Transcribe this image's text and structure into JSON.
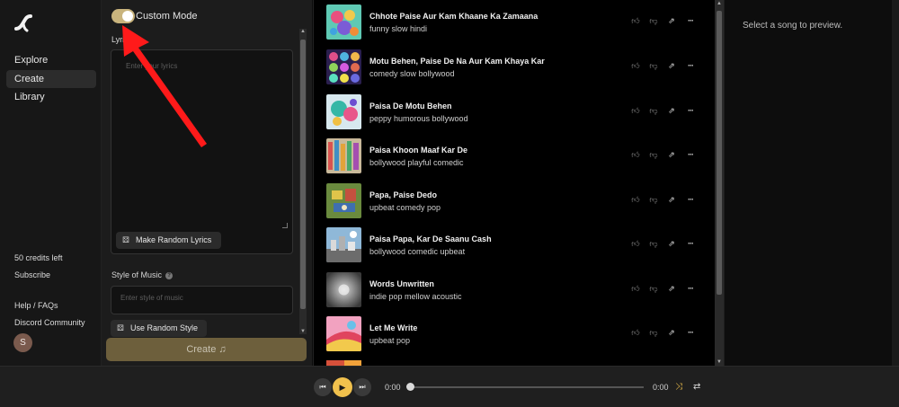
{
  "nav": {
    "items": [
      {
        "label": "Explore"
      },
      {
        "label": "Create",
        "active": true
      },
      {
        "label": "Library"
      }
    ],
    "credits": "50 credits left",
    "subscribe": "Subscribe",
    "help": "Help / FAQs",
    "discord": "Discord Community",
    "avatar_initial": "S"
  },
  "create": {
    "mode_label": "Custom Mode",
    "lyrics_label": "Lyrics",
    "lyrics_placeholder": "Enter your lyrics",
    "random_lyrics": "Make Random Lyrics",
    "style_label": "Style of Music",
    "style_placeholder": "Enter style of music",
    "random_style": "Use Random Style",
    "create_label": "Create ♫"
  },
  "songs": [
    {
      "title": "Chhote Paise Aur Kam Khaane Ka Zamaana",
      "tags": "funny slow hindi"
    },
    {
      "title": "Motu Behen, Paise De Na Aur Kam Khaya Kar",
      "tags": "comedy slow bollywood"
    },
    {
      "title": "Paisa De Motu Behen",
      "tags": "peppy humorous bollywood"
    },
    {
      "title": "Paisa Khoon Maaf Kar De",
      "tags": "bollywood playful comedic"
    },
    {
      "title": "Papa, Paise Dedo",
      "tags": "upbeat comedy pop"
    },
    {
      "title": "Paisa Papa, Kar De Saanu Cash",
      "tags": "bollywood comedic upbeat"
    },
    {
      "title": "Words Unwritten",
      "tags": "indie pop mellow acoustic"
    },
    {
      "title": "Let Me Write",
      "tags": "upbeat pop"
    }
  ],
  "preview": {
    "text": "Select a song to preview."
  },
  "player": {
    "current_time": "0:00",
    "duration": "0:00",
    "progress": 0
  },
  "colors": {
    "accent": "#f1c14d",
    "toggle": "#c9b47d",
    "create_button": "#6d5f3c",
    "annotation_arrow": "#ff1a1a"
  }
}
